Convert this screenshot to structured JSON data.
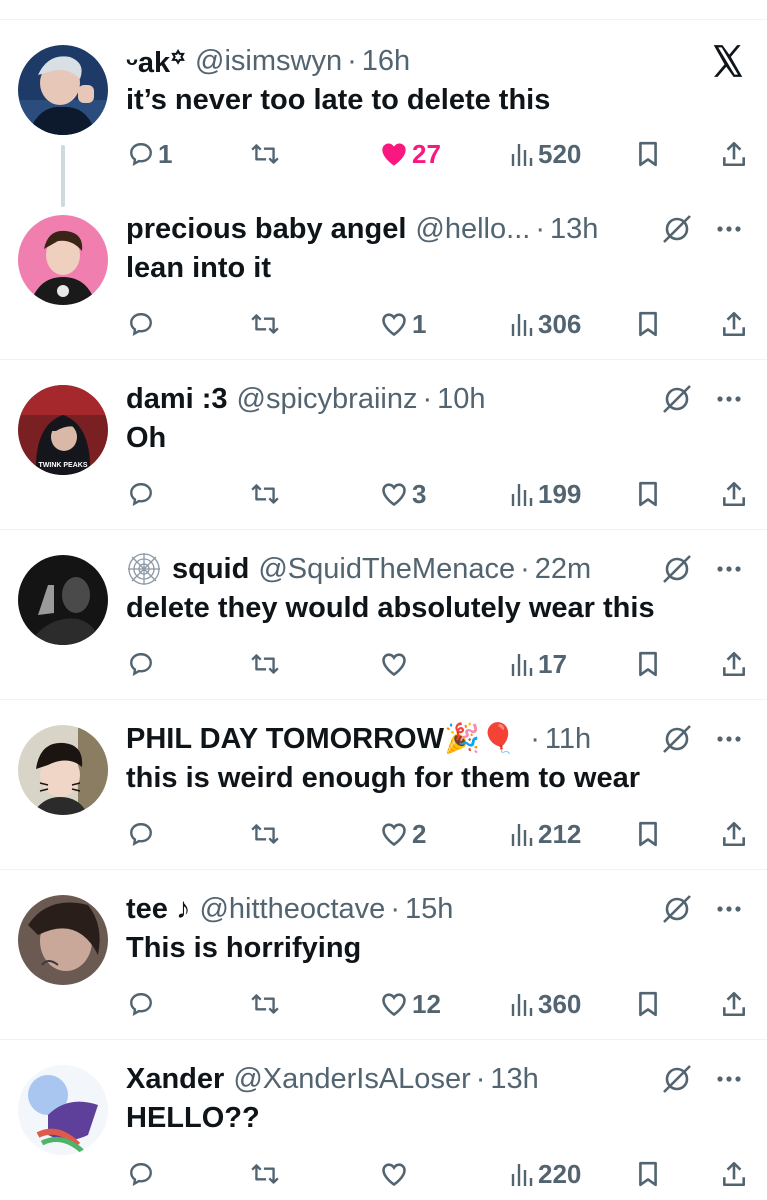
{
  "tweets": [
    {
      "name": "ᵕak꙳",
      "handle": "@isimswyn",
      "time": "16h",
      "text": "it’s never too late to delete this",
      "replies": "1",
      "likes": "27",
      "views": "520"
    },
    {
      "name": "precious baby angel",
      "handle": "@hello...",
      "time": "13h",
      "text": "lean into it",
      "replies": "",
      "likes": "1",
      "views": "306"
    },
    {
      "name": "dami :3",
      "handle": "@spicybraiinz",
      "time": "10h",
      "text": "Oh",
      "replies": "",
      "likes": "3",
      "views": "199",
      "avatar_caption": "TWINK PEAKS"
    },
    {
      "name": "squid",
      "handle": "@SquidTheMenace",
      "time": "22m",
      "text": "delete they would absolutely wear this",
      "replies": "",
      "likes": "",
      "views": "17"
    },
    {
      "name": "PHIL DAY TOMORROW🎉🎈",
      "handle": "",
      "time": "11h",
      "text": "this is weird enough for them to wear",
      "replies": "",
      "likes": "2",
      "views": "212"
    },
    {
      "name": "tee ♪",
      "handle": "@hittheoctave",
      "time": "15h",
      "text": "This is horrifying",
      "replies": "",
      "likes": "12",
      "views": "360"
    },
    {
      "name": "Xander",
      "handle": "@XanderIsALoser",
      "time": "13h",
      "text": "HELLO??",
      "replies": "",
      "likes": "",
      "views": "220"
    }
  ],
  "separator": "·",
  "colors": {
    "like_active": "#f91880",
    "meta": "#536471",
    "text": "#0f1419",
    "divider": "#eff3f4"
  },
  "icons": [
    "reply-icon",
    "retweet-icon",
    "like-icon",
    "views-icon",
    "bookmark-icon",
    "share-icon",
    "grok-icon",
    "more-icon",
    "x-logo-icon",
    "spiderweb-icon"
  ]
}
